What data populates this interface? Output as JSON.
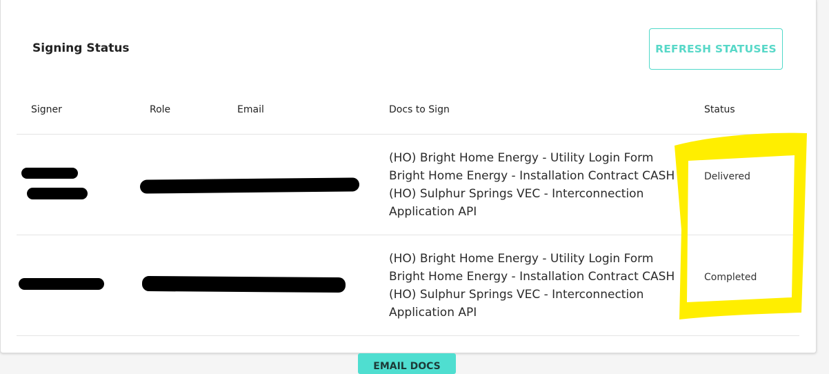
{
  "card": {
    "title": "Signing Status",
    "refresh_label": "REFRESH STATUSES"
  },
  "table": {
    "headers": {
      "signer": "Signer",
      "role": "Role",
      "email": "Email",
      "docs": "Docs to Sign",
      "status": "Status"
    },
    "rows": [
      {
        "docs": [
          "(HO) Bright Home Energy - Utility Login Form",
          "Bright Home Energy - Installation Contract CASH",
          "(HO) Sulphur Springs VEC - Interconnection",
          "Application API"
        ],
        "status": "Delivered"
      },
      {
        "docs": [
          "(HO) Bright Home Energy - Utility Login Form",
          "Bright Home Energy - Installation Contract CASH",
          "(HO) Sulphur Springs VEC - Interconnection",
          "Application API"
        ],
        "status": "Completed"
      }
    ]
  },
  "footer": {
    "email_docs_label": "EMAIL DOCS"
  },
  "colors": {
    "accent": "#4fd9c9",
    "highlight": "#ffee00",
    "redaction": "#000000"
  }
}
